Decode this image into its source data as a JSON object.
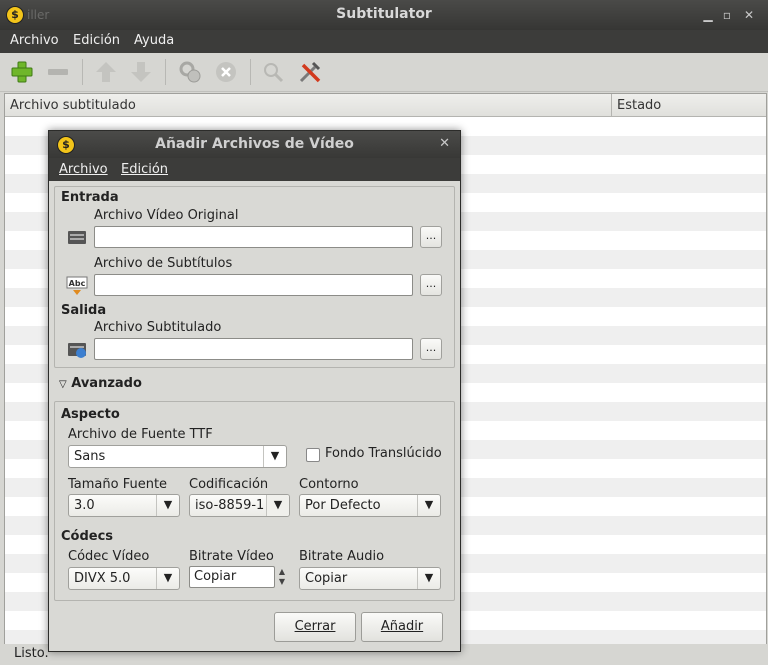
{
  "window": {
    "title": "Subtitulator",
    "ghost_text": "iller"
  },
  "menu": {
    "archivo": "Archivo",
    "edicion": "Edición",
    "ayuda": "Ayuda"
  },
  "toolbar": {
    "icons": [
      "add-icon",
      "remove-icon",
      "move-up-icon",
      "move-down-icon",
      "process-icon",
      "stop-icon",
      "search-icon",
      "tools-icon"
    ]
  },
  "table": {
    "col_file": "Archivo subtitulado",
    "col_state": "Estado"
  },
  "status": {
    "text": "Listo."
  },
  "dialog": {
    "title": "Añadir Archivos de Vídeo",
    "menu": {
      "archivo": "Archivo",
      "edicion": "Edición"
    },
    "entrada": {
      "header": "Entrada",
      "video_label": "Archivo Vídeo Original",
      "video_value": "",
      "subs_label": "Archivo de Subtítulos",
      "subs_value": "",
      "browse": "..."
    },
    "salida": {
      "header": "Salida",
      "out_label": "Archivo Subtitulado",
      "out_value": ""
    },
    "avanzado": {
      "label": "Avanzado",
      "expanded": true
    },
    "aspecto": {
      "header": "Aspecto",
      "font_label": "Archivo de Fuente TTF",
      "font_value": "Sans",
      "translucent_label": "Fondo Translúcido",
      "translucent_checked": false,
      "size_label": "Tamaño Fuente",
      "size_value": "3.0",
      "enc_label": "Codificación",
      "enc_value": "iso-8859-1",
      "outline_label": "Contorno",
      "outline_value": "Por Defecto"
    },
    "codecs": {
      "header": "Códecs",
      "vcodec_label": "Códec Vídeo",
      "vcodec_value": "DIVX 5.0",
      "vbitrate_label": "Bitrate Vídeo",
      "vbitrate_value": "Copiar",
      "abitrate_label": "Bitrate Audio",
      "abitrate_value": "Copiar"
    },
    "buttons": {
      "close": "Cerrar",
      "add": "Añadir"
    }
  },
  "colors": {
    "accent_green": "#6fb62a",
    "logo_yellow": "#f2c41a"
  }
}
